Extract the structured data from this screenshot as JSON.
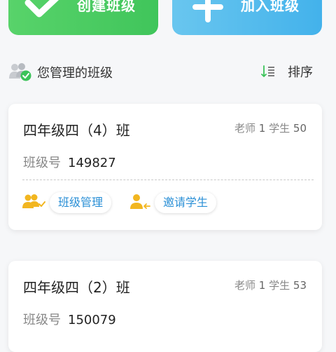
{
  "actions": {
    "create_class": "创建班级",
    "join_class": "加入班级"
  },
  "section": {
    "title": "您管理的班级",
    "sort_label": "排序"
  },
  "classes": [
    {
      "name": "四年级四（4）班",
      "teacher_label": "老师",
      "teacher_count": "1",
      "student_label": "学生",
      "student_count": "50",
      "code_label": "班级号",
      "code": "149827",
      "manage_label": "班级管理",
      "invite_label": "邀请学生"
    },
    {
      "name": "四年级四（2）班",
      "teacher_label": "老师",
      "teacher_count": "1",
      "student_label": "学生",
      "student_count": "53",
      "code_label": "班级号",
      "code": "150079"
    }
  ],
  "icons": {
    "create": "check-icon",
    "join": "plus-icon",
    "section": "group-check-icon",
    "sort": "sort-icon",
    "manage": "people-check-icon",
    "invite": "person-add-icon"
  },
  "colors": {
    "create_button": "#4cc962",
    "join_button": "#55bbec",
    "accent_yellow": "#f2b620",
    "chip_text": "#2a8fd6",
    "section_icon_green": "#3cc35a"
  }
}
